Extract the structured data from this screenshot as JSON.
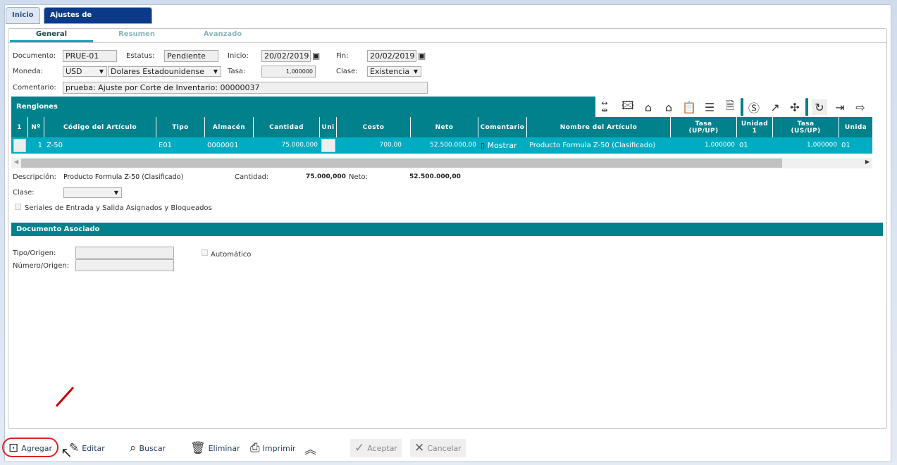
{
  "tabs": [
    {
      "label": "Inicio"
    },
    {
      "label": "Ajustes de Inventarios",
      "close": "×"
    }
  ],
  "subtabs": [
    "General",
    "Resumen",
    "Avanzado"
  ],
  "form": {
    "documento_label": "Documento:",
    "documento": "PRUE-01",
    "estatus_label": "Estatus:",
    "estatus": "Pendiente",
    "inicio_label": "Inicio:",
    "inicio": "20/02/2019",
    "fin_label": "Fin:",
    "fin": "20/02/2019",
    "moneda_label": "Moneda:",
    "moneda": "USD",
    "moneda_nombre": "Dolares Estadounidense",
    "tasa_label": "Tasa:",
    "tasa": "1,000000",
    "clase_label": "Clase:",
    "clase": "Existencia",
    "comentario_label": "Comentario:",
    "comentario": "prueba: Ajuste por Corte de Inventario: 00000037"
  },
  "renglones": {
    "title": "Renglones",
    "columns": [
      "1",
      "Nº",
      "Código del Artículo",
      "Tipo",
      "Almacén",
      "Cantidad",
      "Uni",
      "Costo",
      "Neto",
      "Comentario",
      "Nombre del Artículo",
      "Tasa (UP/UP)",
      "Unidad 1",
      "Tasa (US/UP)",
      "Unida"
    ],
    "row": {
      "num": "1",
      "codigo": "Z-50",
      "tipo": "E01",
      "almacen": "0000001",
      "cantidad": "75.000,000",
      "costo": "700,00",
      "neto": "52.500.000,00",
      "comentario": "Mostrar",
      "nombre": "Producto Formula Z-50 (Clasificado)",
      "tasa_up": "1,000000",
      "unidad1": "01",
      "tasa_us": "1,000000",
      "unidad2": "01"
    }
  },
  "detail": {
    "descripcion_label": "Descripción:",
    "descripcion": "Producto Formula Z-50 (Clasificado)",
    "cantidad_label": "Cantidad:",
    "cantidad": "75.000,000",
    "neto_label": "Neto:",
    "neto": "52.500.000,00",
    "clase_label": "Clase:",
    "seriales": "Seriales de Entrada y Salida Asignados y Bloqueados"
  },
  "asociado": {
    "title": "Documento Asociado",
    "tipo_label": "Tipo/Origen:",
    "numero_label": "Número/Origen:",
    "automatico": "Automático"
  },
  "toolbar": {
    "agregar": "Agregar",
    "editar": "Editar",
    "buscar": "Buscar",
    "eliminar": "Eliminar",
    "imprimir": "Imprimir",
    "aceptar": "Aceptar",
    "cancelar": "Cancelar"
  },
  "colors": {
    "teal": "#00818b",
    "row": "#00acc1",
    "tab_active": "#0b3a88"
  }
}
